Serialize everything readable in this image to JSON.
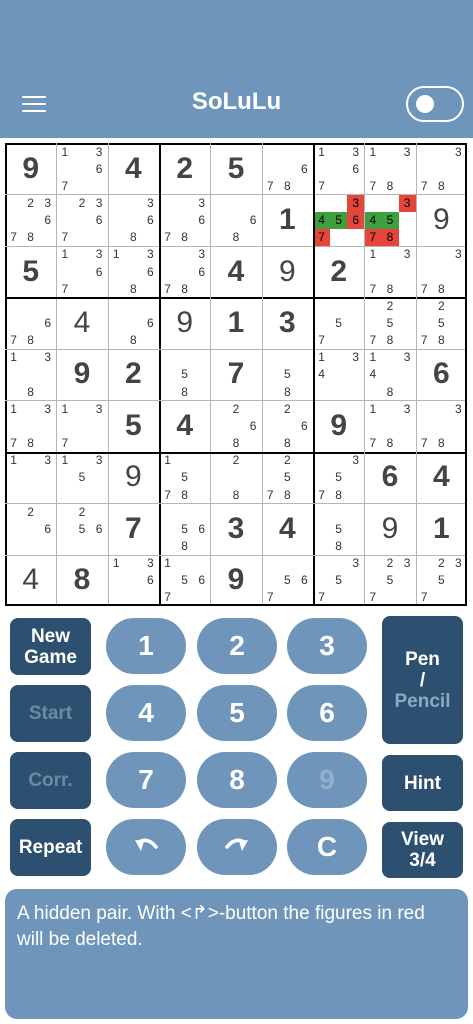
{
  "app": {
    "title": "SoLuLu"
  },
  "toggle": {
    "state": "off"
  },
  "board": {
    "rows": [
      [
        {
          "v": "9"
        },
        {
          "c": [
            "1",
            "",
            "3",
            "",
            "",
            "6",
            "7",
            "",
            ""
          ]
        },
        {
          "v": "4"
        },
        {
          "v": "2"
        },
        {
          "v": "5"
        },
        {
          "c": [
            "",
            "",
            "",
            "",
            "",
            "6",
            "7",
            "8",
            ""
          ]
        },
        {
          "c": [
            "1",
            "",
            "3",
            "",
            "",
            "6",
            "7",
            "",
            ""
          ]
        },
        {
          "c": [
            "1",
            "",
            "3",
            "",
            "",
            "",
            "7",
            "8",
            ""
          ]
        },
        {
          "c": [
            "",
            "",
            "3",
            "",
            "",
            "",
            "7",
            "8",
            ""
          ]
        }
      ],
      [
        {
          "c": [
            "",
            "2",
            "3",
            "",
            "",
            "6",
            "7",
            "8",
            ""
          ]
        },
        {
          "c": [
            "",
            "2",
            "3",
            "",
            "",
            "6",
            "7",
            "",
            ""
          ]
        },
        {
          "c": [
            "",
            "",
            "3",
            "",
            "",
            "6",
            "",
            "8",
            ""
          ]
        },
        {
          "c": [
            "",
            "",
            "3",
            "",
            "",
            "6",
            "7",
            "8",
            ""
          ]
        },
        {
          "c": [
            "",
            "",
            "",
            "",
            "",
            "6",
            "",
            "8",
            ""
          ]
        },
        {
          "v": "1",
          "given": true
        },
        {
          "c": [
            "",
            "",
            "3",
            "4",
            "5",
            "6",
            "7",
            "",
            ""
          ],
          "hl": {
            "3": "red",
            "4": "green",
            "5": "green",
            "6": "red",
            "7": "red"
          }
        },
        {
          "c": [
            "",
            "",
            "3",
            "4",
            "5",
            "",
            "7",
            "8",
            ""
          ],
          "hl": {
            "3": "red",
            "4": "green",
            "5": "green",
            "7": "red",
            "8": "red"
          }
        },
        {
          "v": "9",
          "light": true
        }
      ],
      [
        {
          "v": "5"
        },
        {
          "c": [
            "1",
            "",
            "3",
            "",
            "",
            "6",
            "7",
            "",
            ""
          ]
        },
        {
          "c": [
            "1",
            "",
            "3",
            "",
            "",
            "6",
            "",
            "8",
            ""
          ]
        },
        {
          "c": [
            "",
            "",
            "3",
            "",
            "",
            "6",
            "7",
            "8",
            ""
          ]
        },
        {
          "v": "4"
        },
        {
          "v": "9",
          "light": true
        },
        {
          "v": "2"
        },
        {
          "c": [
            "1",
            "",
            "3",
            "",
            "",
            "",
            "7",
            "8",
            ""
          ]
        },
        {
          "c": [
            "",
            "",
            "3",
            "",
            "",
            "",
            "7",
            "8",
            ""
          ]
        }
      ],
      [
        {
          "c": [
            "",
            "",
            "",
            "",
            "",
            "6",
            "7",
            "8",
            ""
          ]
        },
        {
          "v": "4",
          "light": true
        },
        {
          "c": [
            "",
            "",
            "",
            "",
            "",
            "6",
            "",
            "8",
            ""
          ]
        },
        {
          "v": "9",
          "light": true
        },
        {
          "v": "1"
        },
        {
          "v": "3"
        },
        {
          "c": [
            "",
            "",
            "",
            "",
            "5",
            "",
            "7",
            "",
            ""
          ]
        },
        {
          "c": [
            "",
            "2",
            "",
            "",
            "5",
            "",
            "7",
            "8",
            ""
          ]
        },
        {
          "c": [
            "",
            "2",
            "",
            "",
            "5",
            "",
            "7",
            "8",
            ""
          ]
        }
      ],
      [
        {
          "c": [
            "1",
            "",
            "3",
            "",
            "",
            "",
            "",
            "8",
            ""
          ]
        },
        {
          "v": "9"
        },
        {
          "v": "2"
        },
        {
          "c": [
            "",
            "",
            "",
            "",
            "5",
            "",
            "",
            "8",
            ""
          ]
        },
        {
          "v": "7"
        },
        {
          "c": [
            "",
            "",
            "",
            "",
            "5",
            "",
            "",
            "8",
            ""
          ]
        },
        {
          "c": [
            "1",
            "",
            "3",
            "4",
            "",
            "",
            "",
            "",
            ""
          ]
        },
        {
          "c": [
            "1",
            "",
            "3",
            "4",
            "",
            "",
            "",
            "8",
            ""
          ]
        },
        {
          "v": "6"
        }
      ],
      [
        {
          "c": [
            "1",
            "",
            "3",
            "",
            "",
            "",
            "7",
            "8",
            ""
          ]
        },
        {
          "c": [
            "1",
            "",
            "3",
            "",
            "",
            "",
            "7",
            "",
            ""
          ]
        },
        {
          "v": "5"
        },
        {
          "v": "4"
        },
        {
          "c": [
            "",
            "2",
            "",
            "",
            "",
            "6",
            "",
            "8",
            ""
          ]
        },
        {
          "c": [
            "",
            "2",
            "",
            "",
            "",
            "6",
            "",
            "8",
            ""
          ]
        },
        {
          "v": "9"
        },
        {
          "c": [
            "1",
            "",
            "3",
            "",
            "",
            "",
            "7",
            "8",
            ""
          ]
        },
        {
          "c": [
            "",
            "",
            "3",
            "",
            "",
            "",
            "7",
            "8",
            ""
          ]
        }
      ],
      [
        {
          "c": [
            "1",
            "",
            "3",
            "",
            "",
            "",
            "",
            "",
            ""
          ]
        },
        {
          "c": [
            "1",
            "",
            "3",
            "",
            "5",
            "",
            "",
            "",
            ""
          ]
        },
        {
          "v": "9",
          "light": true
        },
        {
          "c": [
            "1",
            "",
            "",
            "",
            "5",
            "",
            "7",
            "8",
            ""
          ]
        },
        {
          "c": [
            "",
            "2",
            "",
            "",
            "",
            "",
            "",
            "8",
            ""
          ]
        },
        {
          "c": [
            "",
            "2",
            "",
            "",
            "5",
            "",
            "7",
            "8",
            ""
          ]
        },
        {
          "c": [
            "",
            "",
            "3",
            "",
            "5",
            "",
            "7",
            "8",
            ""
          ]
        },
        {
          "v": "6"
        },
        {
          "v": "4"
        }
      ],
      [
        {
          "c": [
            "",
            "2",
            "",
            "",
            "",
            "6",
            "",
            "",
            ""
          ]
        },
        {
          "c": [
            "",
            "2",
            "",
            "",
            "5",
            "6",
            "",
            "",
            ""
          ]
        },
        {
          "v": "7"
        },
        {
          "c": [
            "",
            "",
            "",
            "",
            "5",
            "6",
            "",
            "8",
            ""
          ]
        },
        {
          "v": "3"
        },
        {
          "v": "4"
        },
        {
          "c": [
            "",
            "",
            "",
            "",
            "5",
            "",
            "",
            "8",
            ""
          ]
        },
        {
          "v": "9",
          "light": true
        },
        {
          "v": "1"
        }
      ],
      [
        {
          "v": "4",
          "light": true
        },
        {
          "v": "8"
        },
        {
          "c": [
            "1",
            "",
            "3",
            "",
            "",
            "6",
            "",
            "",
            ""
          ]
        },
        {
          "c": [
            "1",
            "",
            "",
            "",
            "5",
            "6",
            "7",
            "",
            ""
          ]
        },
        {
          "v": "9"
        },
        {
          "c": [
            "",
            "",
            "",
            "",
            "5",
            "6",
            "7",
            "",
            ""
          ]
        },
        {
          "c": [
            "",
            "",
            "3",
            "",
            "5",
            "",
            "7",
            "",
            ""
          ]
        },
        {
          "c": [
            "",
            "2",
            "3",
            "",
            "5",
            "",
            "7",
            "",
            ""
          ]
        },
        {
          "c": [
            "",
            "2",
            "3",
            "",
            "5",
            "",
            "7",
            "",
            ""
          ]
        }
      ]
    ]
  },
  "colors": {
    "primary": "#6f96ba",
    "dark": "#2d5070",
    "red": "#e5453a",
    "green": "#3f9f3f"
  },
  "buttons": {
    "new_game": "New Game",
    "start": "Start",
    "corr": "Corr.",
    "repeat": "Repeat",
    "pen_a": "Pen",
    "pen_b": "/",
    "pen_c": "Pencil",
    "hint": "Hint",
    "view": "View",
    "view_b": "3/4",
    "clear": "C"
  },
  "numbers": [
    "1",
    "2",
    "3",
    "4",
    "5",
    "6",
    "7",
    "8",
    "9"
  ],
  "undo_icon": "undo-icon",
  "redo_icon": "redo-icon",
  "message": "A hidden pair. With <↱>-button the figures in red will be deleted."
}
